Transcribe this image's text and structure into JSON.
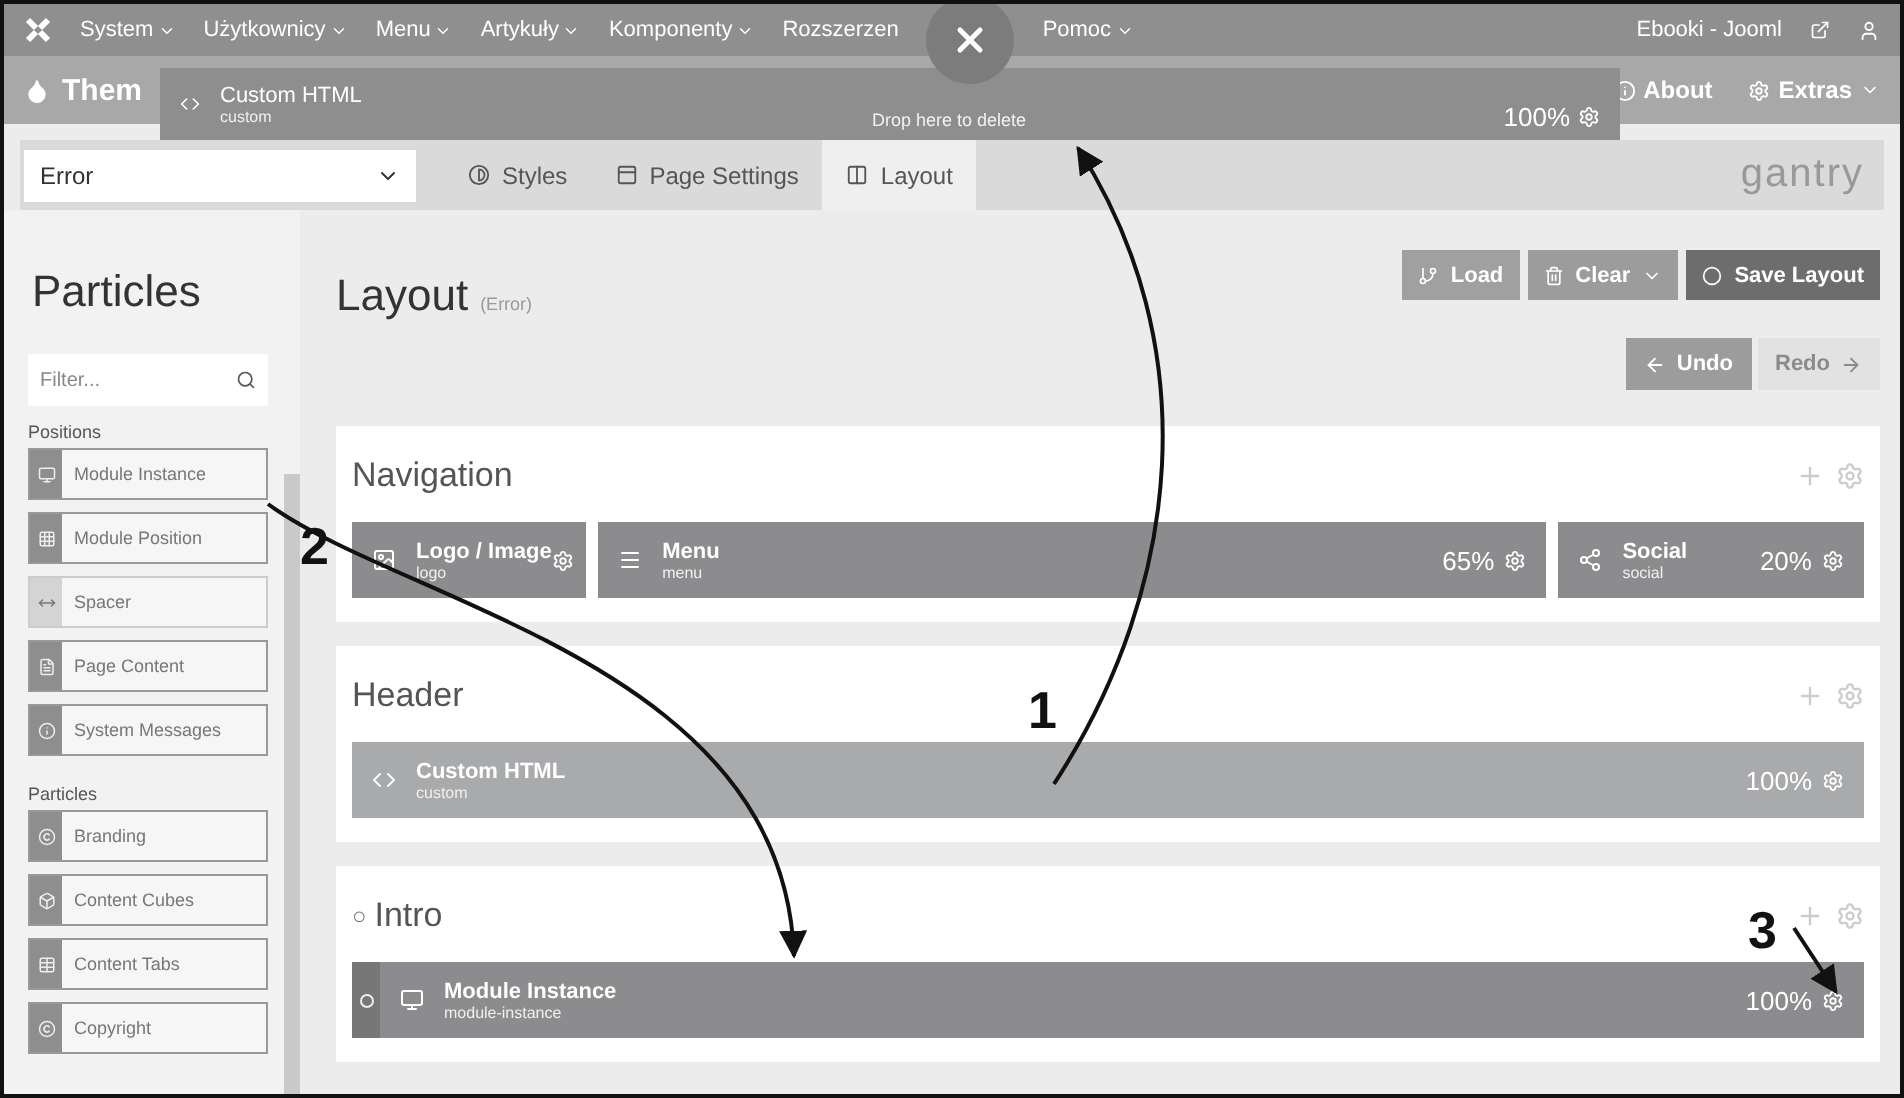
{
  "topbar": {
    "menus": [
      {
        "label": "System",
        "caret": true
      },
      {
        "label": "Użytkownicy",
        "caret": true
      },
      {
        "label": "Menu",
        "caret": true
      },
      {
        "label": "Artykuły",
        "caret": true
      },
      {
        "label": "Komponenty",
        "caret": true
      },
      {
        "label": "Rozszerzen",
        "caret": false
      },
      {
        "label": "Pomoc",
        "caret": true
      }
    ],
    "site": "Ebooki - Jooml"
  },
  "header": {
    "title": "Them",
    "links": [
      {
        "label": "About",
        "caret": false
      },
      {
        "label": "Extras",
        "caret": true
      }
    ]
  },
  "drag": {
    "title": "Custom HTML",
    "subtitle": "custom",
    "size": "100%",
    "drop_hint": "Drop here to delete"
  },
  "toolbar": {
    "select": "Error",
    "tabs": [
      {
        "label": "Styles",
        "selected": false
      },
      {
        "label": "Page Settings",
        "selected": false
      },
      {
        "label": "Layout",
        "selected": true
      }
    ],
    "logo": "gantry"
  },
  "sidebar": {
    "title": "Particles",
    "filter_placeholder": "Filter...",
    "groups": [
      {
        "label": "Positions",
        "items": [
          {
            "label": "Module Instance",
            "faded": false
          },
          {
            "label": "Module Position",
            "faded": false
          },
          {
            "label": "Spacer",
            "faded": true
          },
          {
            "label": "Page Content",
            "faded": false
          },
          {
            "label": "System Messages",
            "faded": false
          }
        ]
      },
      {
        "label": "Particles",
        "items": [
          {
            "label": "Branding",
            "faded": false
          },
          {
            "label": "Content Cubes",
            "faded": false
          },
          {
            "label": "Content Tabs",
            "faded": false
          },
          {
            "label": "Copyright",
            "faded": false
          }
        ]
      }
    ]
  },
  "layout": {
    "title": "Layout",
    "subtitle": "(Error)",
    "buttons": [
      {
        "label": "Load",
        "kind": "normal"
      },
      {
        "label": "Clear",
        "kind": "dropdown"
      },
      {
        "label": "Save Layout",
        "kind": "primary"
      }
    ],
    "history": [
      {
        "label": "Undo",
        "disabled": false
      },
      {
        "label": "Redo",
        "disabled": true
      }
    ],
    "sections": [
      {
        "title": "Navigation",
        "particles": [
          {
            "title": "Logo / Image",
            "subtitle": "logo",
            "faded": false,
            "handle": false
          },
          {
            "title": "Menu",
            "subtitle": "menu",
            "size": "65%",
            "faded": false,
            "handle": false
          },
          {
            "title": "Social",
            "subtitle": "social",
            "size": "20%",
            "faded": false,
            "handle": false
          }
        ]
      },
      {
        "title": "Header",
        "particles": [
          {
            "title": "Custom HTML",
            "subtitle": "custom",
            "size": "100%",
            "faded": true,
            "handle": false
          }
        ]
      },
      {
        "marker": "○",
        "title": "Intro",
        "particles": [
          {
            "title": "Module Instance",
            "subtitle": "module-instance",
            "size": "100%",
            "faded": false,
            "handle": true
          }
        ]
      }
    ]
  },
  "annotations": [
    {
      "label": "1"
    },
    {
      "label": "2"
    },
    {
      "label": "3"
    }
  ]
}
